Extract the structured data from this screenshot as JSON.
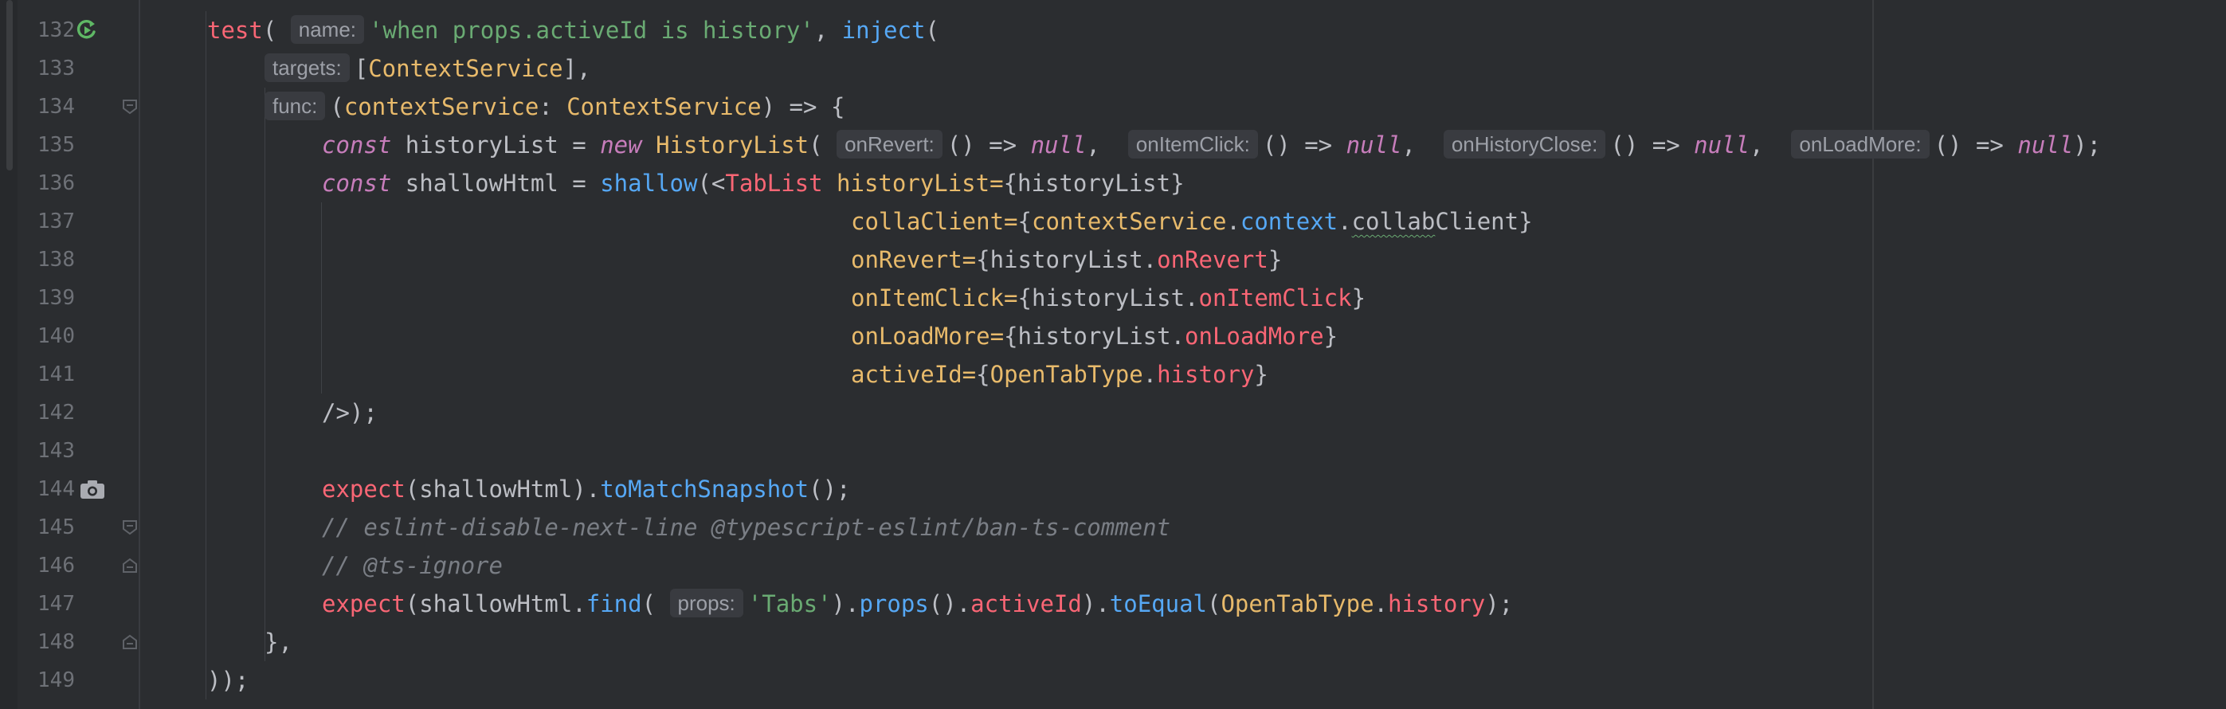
{
  "lines": [
    {
      "num": "132",
      "tokens": [
        {
          "t": "test",
          "c": "call"
        },
        {
          "t": "( "
        },
        {
          "hint": "name:"
        },
        {
          "t": "'when props.activeId is history'",
          "c": "str"
        },
        {
          "t": ", "
        },
        {
          "t": "inject",
          "c": "fn"
        },
        {
          "t": "("
        }
      ]
    },
    {
      "num": "133",
      "tokens": [
        {
          "hint": "targets:"
        },
        {
          "t": "["
        },
        {
          "t": "ContextService",
          "c": "type"
        },
        {
          "t": "],"
        }
      ]
    },
    {
      "num": "134",
      "tokens": [
        {
          "hint": "func:"
        },
        {
          "t": "("
        },
        {
          "t": "contextService",
          "c": "type"
        },
        {
          "t": ": "
        },
        {
          "t": "ContextService",
          "c": "type"
        },
        {
          "t": ") => {"
        }
      ]
    },
    {
      "num": "135",
      "tokens": [
        {
          "t": "const",
          "c": "kw"
        },
        {
          "t": " historyList = "
        },
        {
          "t": "new",
          "c": "kw"
        },
        {
          "t": " "
        },
        {
          "t": "HistoryList",
          "c": "type"
        },
        {
          "t": "( "
        },
        {
          "hint": "onRevert:"
        },
        {
          "t": "() => "
        },
        {
          "t": "null",
          "c": "nul"
        },
        {
          "t": ",  "
        },
        {
          "hint": "onItemClick:"
        },
        {
          "t": "() => "
        },
        {
          "t": "null",
          "c": "nul"
        },
        {
          "t": ",  "
        },
        {
          "hint": "onHistoryClose:"
        },
        {
          "t": "() => "
        },
        {
          "t": "null",
          "c": "nul"
        },
        {
          "t": ",  "
        },
        {
          "hint": "onLoadMore:"
        },
        {
          "t": "() => "
        },
        {
          "t": "null",
          "c": "nul"
        },
        {
          "t": ");"
        }
      ]
    },
    {
      "num": "136",
      "tokens": [
        {
          "t": "const",
          "c": "kw"
        },
        {
          "t": " shallowHtml = "
        },
        {
          "t": "shallow",
          "c": "fn"
        },
        {
          "t": "(<"
        },
        {
          "t": "TabList",
          "c": "tag"
        },
        {
          "t": " "
        },
        {
          "t": "historyList=",
          "c": "attr"
        },
        {
          "t": "{historyList}"
        }
      ]
    },
    {
      "num": "137",
      "tokens": [
        {
          "t": "collaClient=",
          "c": "attr"
        },
        {
          "t": "{"
        },
        {
          "t": "contextService",
          "c": "type"
        },
        {
          "t": "."
        },
        {
          "t": "context",
          "c": "mem"
        },
        {
          "t": "."
        },
        {
          "t": "collab",
          "c": "squig"
        },
        {
          "t": "Client}"
        }
      ]
    },
    {
      "num": "138",
      "tokens": [
        {
          "t": "onRevert=",
          "c": "attr"
        },
        {
          "t": "{historyList."
        },
        {
          "t": "onRevert",
          "c": "prop"
        },
        {
          "t": "}"
        }
      ]
    },
    {
      "num": "139",
      "tokens": [
        {
          "t": "onItemClick=",
          "c": "attr"
        },
        {
          "t": "{historyList."
        },
        {
          "t": "onItemClick",
          "c": "prop"
        },
        {
          "t": "}"
        }
      ]
    },
    {
      "num": "140",
      "tokens": [
        {
          "t": "onLoadMore=",
          "c": "attr"
        },
        {
          "t": "{historyList."
        },
        {
          "t": "onLoadMore",
          "c": "prop"
        },
        {
          "t": "}"
        }
      ]
    },
    {
      "num": "141",
      "tokens": [
        {
          "t": "activeId=",
          "c": "attr"
        },
        {
          "t": "{"
        },
        {
          "t": "OpenTabType",
          "c": "type"
        },
        {
          "t": "."
        },
        {
          "t": "history",
          "c": "prop"
        },
        {
          "t": "}"
        }
      ]
    },
    {
      "num": "142",
      "tokens": [
        {
          "t": "/>);"
        }
      ]
    },
    {
      "num": "143",
      "tokens": []
    },
    {
      "num": "144",
      "tokens": [
        {
          "t": "expect",
          "c": "call"
        },
        {
          "t": "(shallowHtml)."
        },
        {
          "t": "toMatchSnapshot",
          "c": "fn"
        },
        {
          "t": "();"
        }
      ]
    },
    {
      "num": "145",
      "tokens": [
        {
          "t": "// eslint-disable-next-line @typescript-eslint/ban-ts-comment",
          "c": "cmt"
        }
      ]
    },
    {
      "num": "146",
      "tokens": [
        {
          "t": "// @ts-ignore",
          "c": "cmt"
        }
      ]
    },
    {
      "num": "147",
      "tokens": [
        {
          "t": "expect",
          "c": "call"
        },
        {
          "t": "(shallowHtml."
        },
        {
          "t": "find",
          "c": "fn"
        },
        {
          "t": "( "
        },
        {
          "hint": "props:"
        },
        {
          "t": "'Tabs'",
          "c": "str"
        },
        {
          "t": ")."
        },
        {
          "t": "props",
          "c": "fn"
        },
        {
          "t": "()."
        },
        {
          "t": "activeId",
          "c": "prop"
        },
        {
          "t": ")."
        },
        {
          "t": "toEqual",
          "c": "fn"
        },
        {
          "t": "("
        },
        {
          "t": "OpenTabType",
          "c": "type"
        },
        {
          "t": "."
        },
        {
          "t": "history",
          "c": "prop"
        },
        {
          "t": ");"
        }
      ]
    },
    {
      "num": "148",
      "tokens": [
        {
          "t": "},"
        }
      ]
    },
    {
      "num": "149",
      "tokens": [
        {
          "t": "));"
        }
      ]
    }
  ],
  "gutter_icons": {
    "132": "run-test-icon",
    "134": "fold-open-icon",
    "144": "snapshot-camera-icon",
    "145": "fold-open-icon",
    "146": "fold-close-icon",
    "148": "fold-close-icon"
  },
  "colors": {
    "background": "#2b2d30",
    "run_icon": "#5fb865",
    "function_call": "#fa6675",
    "method": "#56a8f5",
    "string": "#6aab73",
    "type": "#e8ba6b",
    "keyword": "#c77dbb",
    "comment": "#7a7e85"
  }
}
